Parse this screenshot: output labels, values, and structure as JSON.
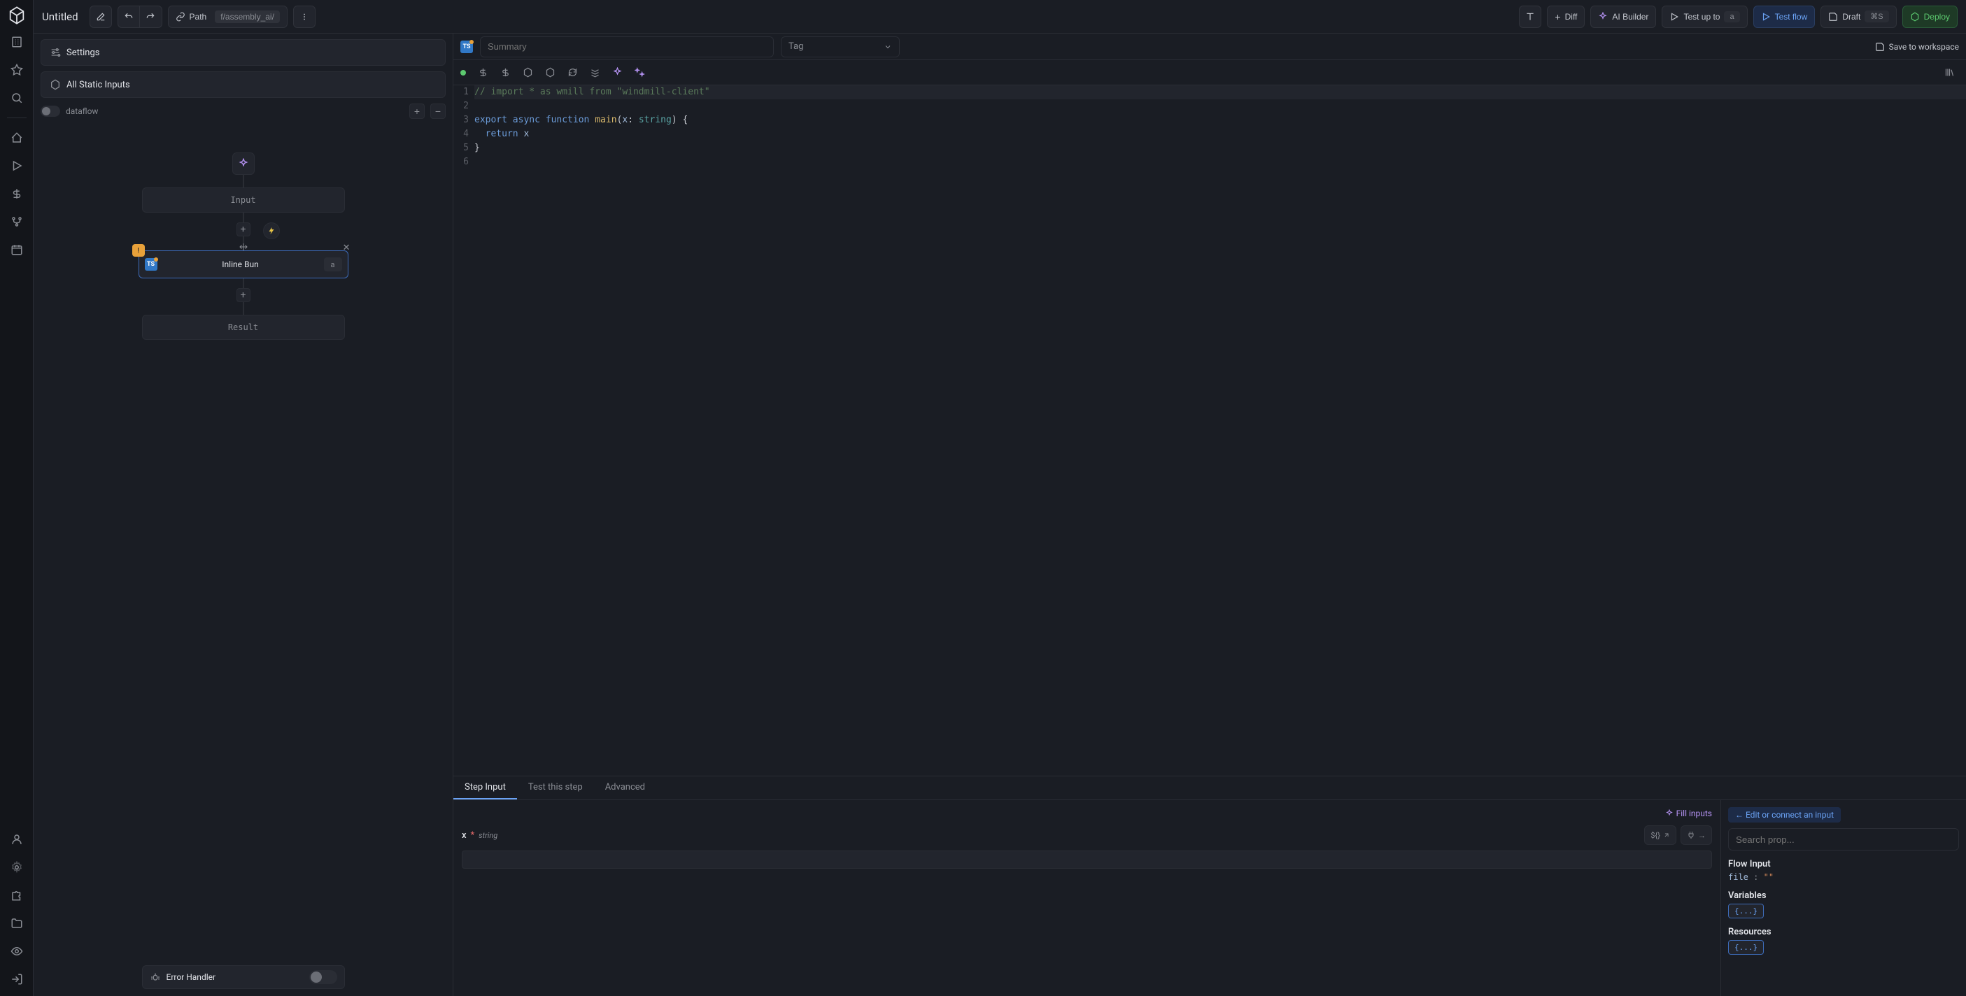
{
  "topbar": {
    "title": "Untitled",
    "path_label": "Path",
    "path_value": "f/assembly_ai/",
    "diff": "Diff",
    "ai": "AI Builder",
    "test_up": "Test up to",
    "test_up_tag": "a",
    "test_flow": "Test flow",
    "draft": "Draft",
    "draft_kbd": "⌘S",
    "deploy": "Deploy"
  },
  "leftpanel": {
    "settings": "Settings",
    "static": "All Static Inputs",
    "dataflow": "dataflow"
  },
  "canvas": {
    "input": "Input",
    "bun": "Inline Bun",
    "bun_tag": "a",
    "result": "Result",
    "err": "Error Handler"
  },
  "header": {
    "summary_ph": "Summary",
    "tag": "Tag",
    "save": "Save to workspace"
  },
  "code": {
    "l1": "// import * as wmill from \"windmill-client\"",
    "l3_kw1": "export ",
    "l3_kw2": "async ",
    "l3_kw3": "function ",
    "l3_fn": "main",
    "l3_rest1": "(",
    "l3_var": "x",
    "l3_rest2": ": ",
    "l3_type": "string",
    "l3_rest3": ") {",
    "l4_kw": "  return ",
    "l4_var": "x",
    "l5": "}"
  },
  "tabs": {
    "step": "Step Input",
    "test": "Test this step",
    "adv": "Advanced"
  },
  "inputs": {
    "fill": "Fill inputs",
    "prop": "x",
    "ptype": "string",
    "expr": "${}"
  },
  "connect": {
    "hint": "← Edit or connect an input",
    "search_ph": "Search prop...",
    "flow": "Flow Input",
    "file_k": "file",
    "file_sep": " : ",
    "file_v": "\"\"",
    "vars": "Variables",
    "res": "Resources",
    "brace": "{...}"
  }
}
